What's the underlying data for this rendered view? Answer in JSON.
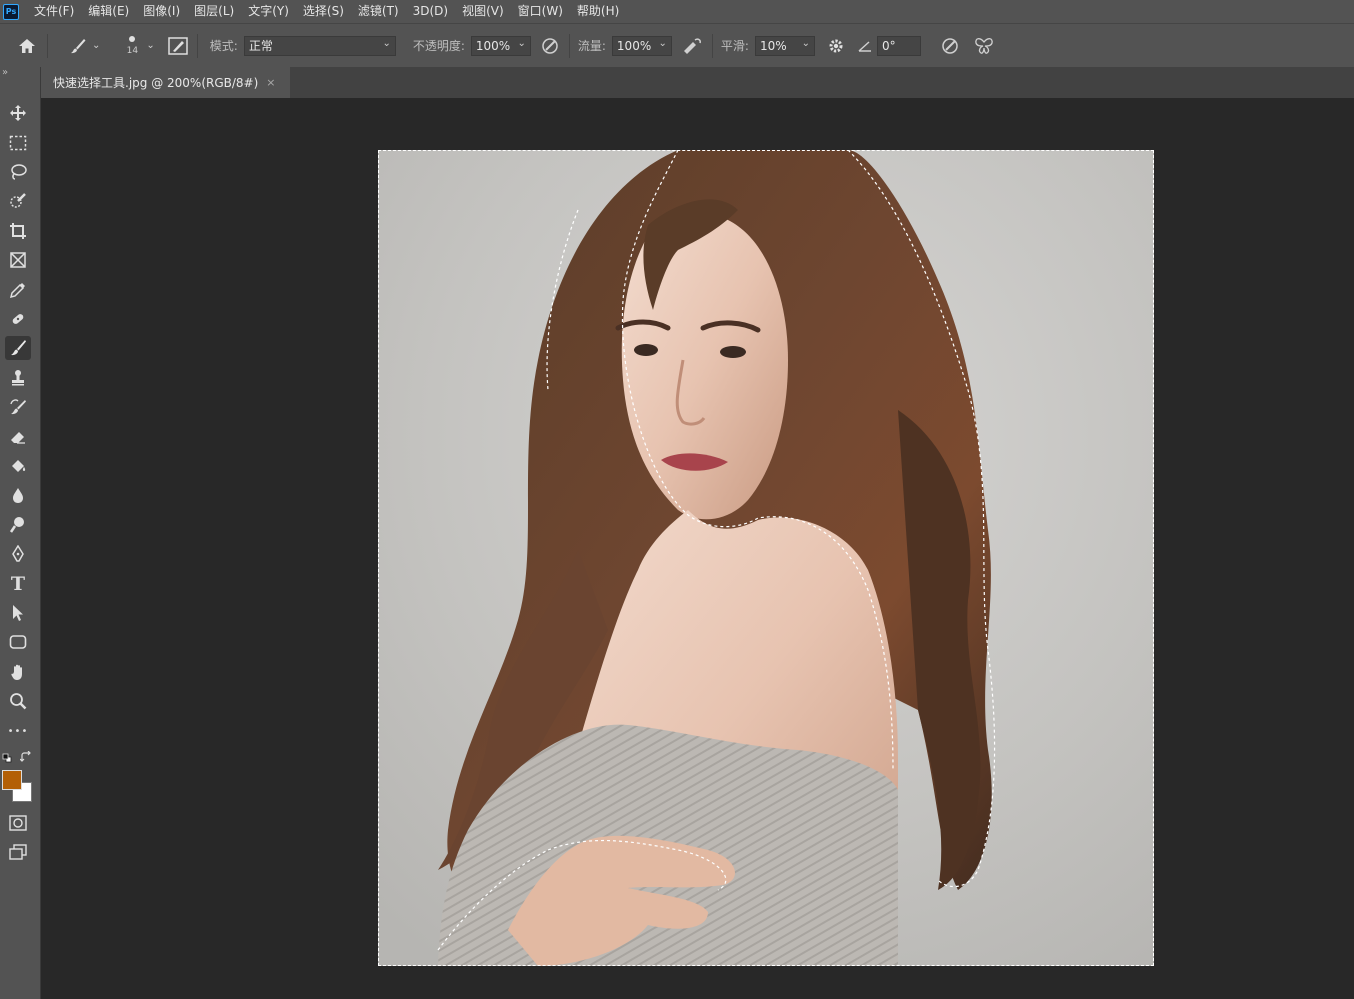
{
  "app": {
    "logo_text": "Ps"
  },
  "menu": [
    "文件(F)",
    "编辑(E)",
    "图像(I)",
    "图层(L)",
    "文字(Y)",
    "选择(S)",
    "滤镜(T)",
    "3D(D)",
    "视图(V)",
    "窗口(W)",
    "帮助(H)"
  ],
  "options": {
    "brush_size": "14",
    "mode_label": "模式:",
    "mode_value": "正常",
    "opacity_label": "不透明度:",
    "opacity_value": "100%",
    "flow_label": "流量:",
    "flow_value": "100%",
    "smoothing_label": "平滑:",
    "smoothing_value": "10%",
    "angle_value": "0°"
  },
  "document": {
    "tab_title": "快速选择工具.jpg @ 200%(RGB/8#)",
    "close_glyph": "×"
  },
  "toolbar": {
    "collapse_glyph": "»",
    "tools": [
      "move-tool",
      "rectangular-marquee-tool",
      "lasso-tool",
      "quick-selection-tool",
      "crop-tool",
      "frame-tool",
      "eyedropper-tool",
      "healing-brush-tool",
      "brush-tool",
      "clone-stamp-tool",
      "history-brush-tool",
      "eraser-tool",
      "paint-bucket-tool",
      "blur-tool",
      "dodge-tool",
      "pen-tool",
      "type-tool",
      "path-selection-tool",
      "rectangle-tool",
      "hand-tool",
      "zoom-tool",
      "edit-toolbar"
    ],
    "active_tool": "brush-tool",
    "type_glyph": "T",
    "more_glyph": "•••"
  },
  "colors": {
    "foreground": "#b35f06",
    "background": "#ffffff",
    "ui_dark": "#282828",
    "ui_panel": "#535353"
  }
}
